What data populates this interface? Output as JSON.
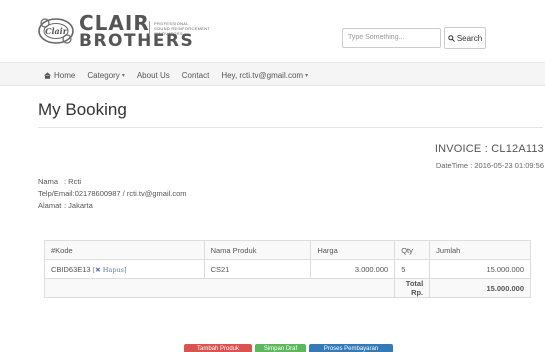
{
  "brand": {
    "name_line1": "CLAIR",
    "name_line2": "BROTHERS",
    "tagline_1": "PROFESSIONAL",
    "tagline_2": "SOUND REINFORCEMENT",
    "tagline_3": "INNOVATORS",
    "mark_text": "Clair"
  },
  "search": {
    "placeholder": "Type Something...",
    "button_label": "Search"
  },
  "nav": {
    "home": "Home",
    "category": "Category",
    "about": "About Us",
    "contact": "Contact",
    "user": "Hey, rcti.tv@gmail.com"
  },
  "page": {
    "title": "My Booking"
  },
  "invoice": {
    "label": "INVOICE : CL12A113",
    "datetime": "DateTime : 2016-05-23 01:09:56"
  },
  "customer": {
    "nama_label": "Nama",
    "nama_value": ": Rcti",
    "telp_label": "Telp/Email",
    "telp_value": ":02178600987 / rcti.tv@gmail.com",
    "alamat_label": "Alamat",
    "alamat_value": ": Jakarta"
  },
  "table": {
    "headers": [
      "#Kode",
      "Nama Produk",
      "Harga",
      "Qty",
      "Jumlah"
    ],
    "rows": [
      {
        "kode": "CBID63E13",
        "hapus": "Hapus",
        "produk": "CS21",
        "harga": "3.000.000",
        "qty": "5",
        "jumlah": "15.000.000"
      }
    ],
    "total_label": "Total Rp.",
    "total_value": "15.000.000"
  },
  "actions": {
    "add": "Tambah Produk",
    "save": "Simpan Draf",
    "pay": "Proses Pembayaran"
  },
  "colors": {
    "red": "#d9534f",
    "green": "#5cb85c",
    "blue": "#337ab7"
  }
}
